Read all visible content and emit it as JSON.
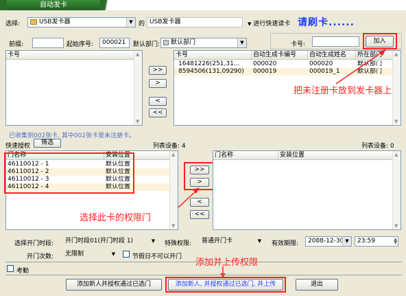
{
  "title": {
    "tab": "自动发卡"
  },
  "top": {
    "select_label": "选择:",
    "reader_combo": "USB发卡器",
    "de_label": "的",
    "reader_name": "USB发卡器",
    "quick_read_label": "进行快速读卡",
    "status": "请刷卡......"
  },
  "fields": {
    "prefix_label": "前缀:",
    "prefix_value": "",
    "start_no_label": "起始序号:",
    "start_no_value": "000021",
    "dept_label": "默认部门:",
    "dept_value": "默认部门",
    "card_no_label": "卡号:",
    "card_no_value": "",
    "add_button": "加入"
  },
  "left_list": {
    "header": "卡号"
  },
  "right_list": {
    "headers": [
      "卡号",
      "自动生成卡编号",
      "自动生成姓名",
      "所在部门"
    ],
    "rows": [
      [
        "16481226(251,31...",
        "000020",
        "000020",
        "默认部门"
      ],
      [
        "8594506(131,09290)",
        "000019",
        "000019_1",
        "默认部门"
      ]
    ]
  },
  "transfer_buttons": {
    "add_all": ">>",
    "add_one": ">",
    "remove_one": "<",
    "remove_all": "<<"
  },
  "notes": {
    "collected": "已收集到002张卡, 其中002张卡是未注册卡。",
    "annot_card": "把未注册卡放到发卡器上",
    "annot_perm": "选择此卡的权限门",
    "annot_upload": "添加并上传权限"
  },
  "quick_auth": {
    "label": "快速授权",
    "filter_button": "筛选",
    "left_count": "列表设备: 4",
    "right_count": "列表设备: 0"
  },
  "door_list": {
    "headers": [
      "门名称",
      "安装位置"
    ],
    "rows": [
      [
        "46110012 - 1",
        "默认位置"
      ],
      [
        "46110012 - 2",
        "默认位置"
      ],
      [
        "46110012 - 3",
        "默认位置"
      ],
      [
        "46110012 - 4",
        "默认位置"
      ]
    ]
  },
  "selected_list": {
    "headers": [
      "门名称",
      "安装位置"
    ]
  },
  "bottom": {
    "time_label": "选择开门时段:",
    "time_value": "开门时段01(开门时段 1)",
    "special_label": "特殊权限:",
    "special_value": "普通开门卡",
    "valid_label": "有效期限:",
    "valid_date": "2088-12-30",
    "valid_time": "23:59",
    "open_count_label": "开门次数:",
    "open_count_value": "无限制",
    "holiday_label": "节假日不可以开门",
    "attendance_label": "考勤"
  },
  "actions": {
    "add_pass": "添加新人并授权通过已选门",
    "add_pass_upload": "添加新人, 并授权通过已选门, 并上传",
    "exit": "退出"
  }
}
